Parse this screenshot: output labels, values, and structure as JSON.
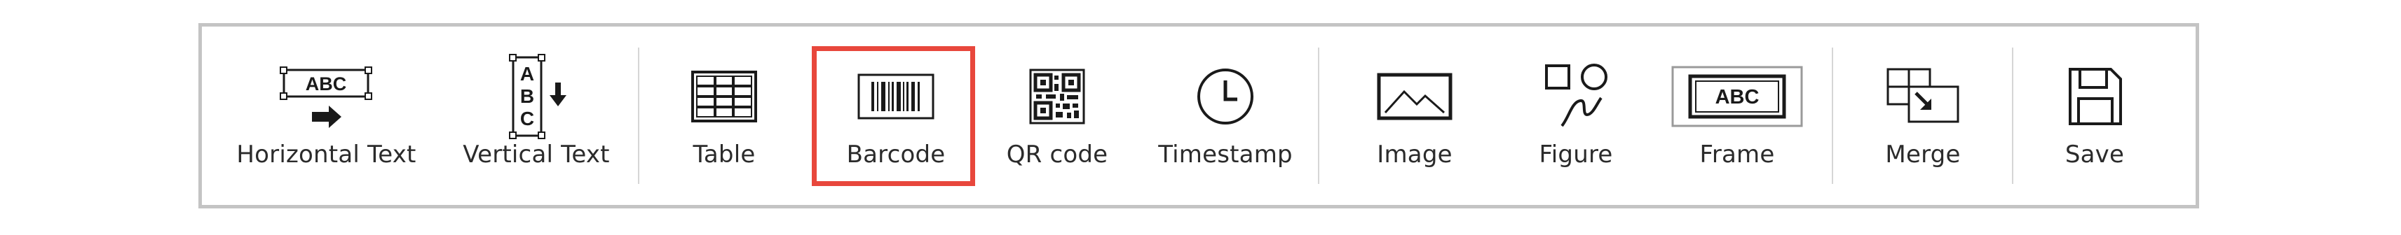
{
  "toolbar": {
    "items": [
      {
        "label": "Horizontal Text",
        "icon": "horizontal-text-icon"
      },
      {
        "label": "Vertical Text",
        "icon": "vertical-text-icon"
      },
      {
        "label": "Table",
        "icon": "table-icon"
      },
      {
        "label": "Barcode",
        "icon": "barcode-icon"
      },
      {
        "label": "QR code",
        "icon": "qr-code-icon"
      },
      {
        "label": "Timestamp",
        "icon": "clock-icon"
      },
      {
        "label": "Image",
        "icon": "image-icon"
      },
      {
        "label": "Figure",
        "icon": "figure-icon"
      },
      {
        "label": "Frame",
        "icon": "frame-icon"
      },
      {
        "label": "Merge",
        "icon": "merge-icon"
      },
      {
        "label": "Save",
        "icon": "save-icon"
      }
    ],
    "icon_text": {
      "horizontal": "ABC",
      "vertical": [
        "A",
        "B",
        "C"
      ],
      "frame": "ABC"
    },
    "selected": "Barcode",
    "colors": {
      "highlight": "#e8473c",
      "border": "#c4c4c4",
      "icon": "#1a1a1a"
    }
  }
}
